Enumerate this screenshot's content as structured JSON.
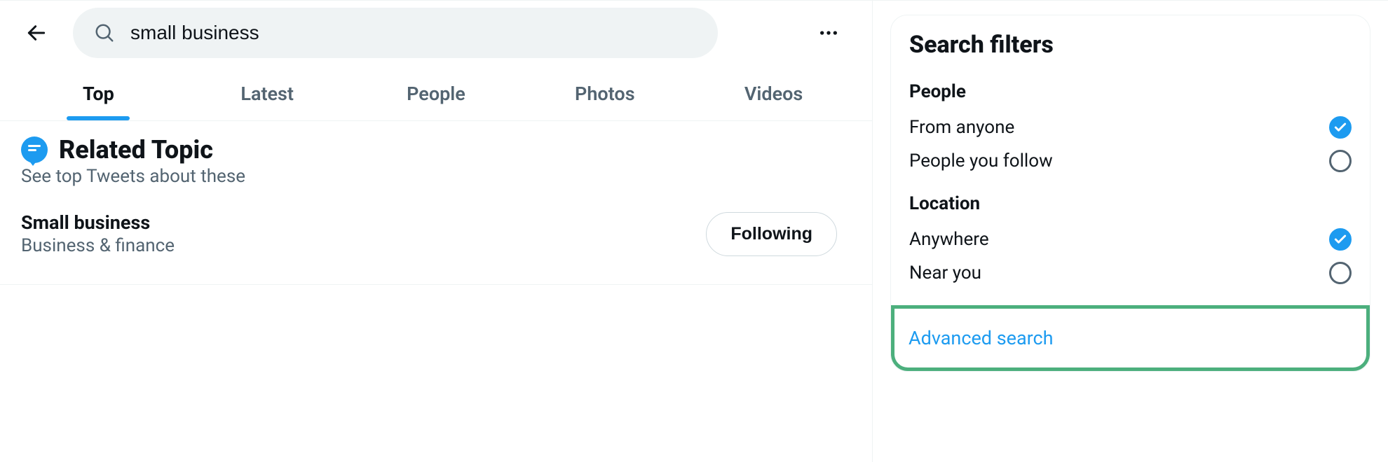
{
  "search": {
    "value": "small business"
  },
  "tabs": [
    {
      "label": "Top",
      "active": true
    },
    {
      "label": "Latest",
      "active": false
    },
    {
      "label": "People",
      "active": false
    },
    {
      "label": "Photos",
      "active": false
    },
    {
      "label": "Videos",
      "active": false
    }
  ],
  "related": {
    "title": "Related Topic",
    "subtitle": "See top Tweets about these",
    "topic": {
      "name": "Small business",
      "category": "Business & finance",
      "button": "Following"
    }
  },
  "filters": {
    "title": "Search filters",
    "groups": [
      {
        "title": "People",
        "options": [
          {
            "label": "From anyone",
            "checked": true
          },
          {
            "label": "People you follow",
            "checked": false
          }
        ]
      },
      {
        "title": "Location",
        "options": [
          {
            "label": "Anywhere",
            "checked": true
          },
          {
            "label": "Near you",
            "checked": false
          }
        ]
      }
    ],
    "advanced_label": "Advanced search"
  }
}
